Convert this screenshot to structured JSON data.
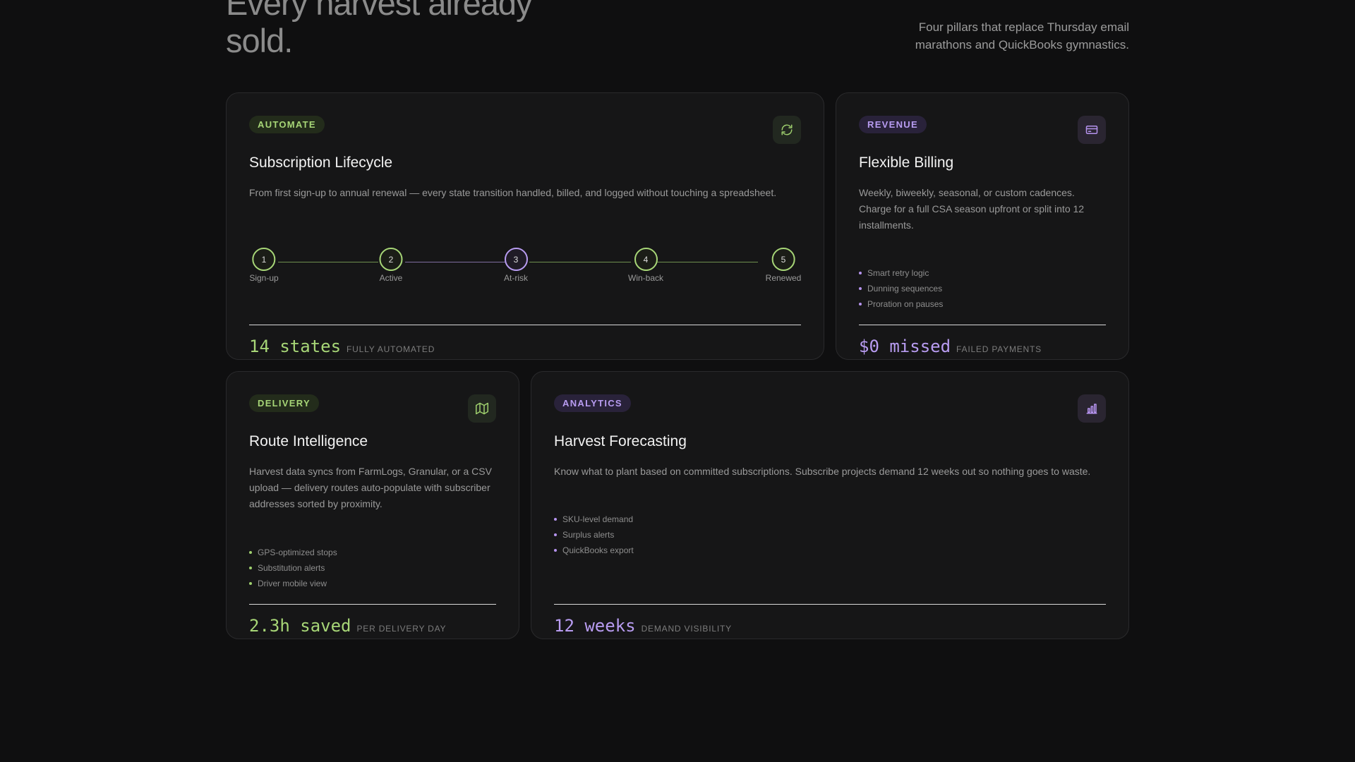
{
  "header": {
    "headline_line1": "Every harvest already",
    "headline_line2": "sold.",
    "intro": "Four pillars that replace Thursday email marathons and QuickBooks gymnastics."
  },
  "cards": {
    "lifecycle": {
      "tag": "AUTOMATE",
      "icon": "refresh-icon",
      "title": "Subscription Lifecycle",
      "description": "From first sign-up to annual renewal — every state transition handled, billed, and logged without touching a spreadsheet.",
      "steps": [
        {
          "num": "1",
          "label": "Sign-up"
        },
        {
          "num": "2",
          "label": "Active"
        },
        {
          "num": "3",
          "label": "At-risk"
        },
        {
          "num": "4",
          "label": "Win-back"
        },
        {
          "num": "5",
          "label": "Renewed"
        }
      ],
      "stat_value": "14 states",
      "stat_label": "FULLY AUTOMATED"
    },
    "billing": {
      "tag": "REVENUE",
      "icon": "credit-card-icon",
      "title": "Flexible Billing",
      "description": "Weekly, biweekly, seasonal, or custom cadences. Charge for a full CSA season upfront or split into 12 installments.",
      "bullets": [
        "Smart retry logic",
        "Dunning sequences",
        "Proration on pauses"
      ],
      "stat_value": "$0 missed",
      "stat_label": "FAILED PAYMENTS"
    },
    "routes": {
      "tag": "DELIVERY",
      "icon": "map-icon",
      "title": "Route Intelligence",
      "description": "Harvest data syncs from FarmLogs, Granular, or a CSV upload — delivery routes auto-populate with subscriber addresses sorted by proximity.",
      "bullets": [
        "GPS-optimized stops",
        "Substitution alerts",
        "Driver mobile view"
      ],
      "stat_value": "2.3h saved",
      "stat_label": "PER DELIVERY DAY"
    },
    "forecasting": {
      "tag": "ANALYTICS",
      "icon": "bar-chart-icon",
      "title": "Harvest Forecasting",
      "description": "Know what to plant based on committed subscriptions. Subscribe projects demand 12 weeks out so nothing goes to waste.",
      "bullets": [
        "SKU-level demand",
        "Surplus alerts",
        "QuickBooks export"
      ],
      "stat_value": "12 weeks",
      "stat_label": "DEMAND VISIBILITY"
    }
  },
  "colors": {
    "accent_green": "#a7d677",
    "accent_purple": "#b89cf1",
    "background": "#0f0f10",
    "card": "#161617"
  }
}
